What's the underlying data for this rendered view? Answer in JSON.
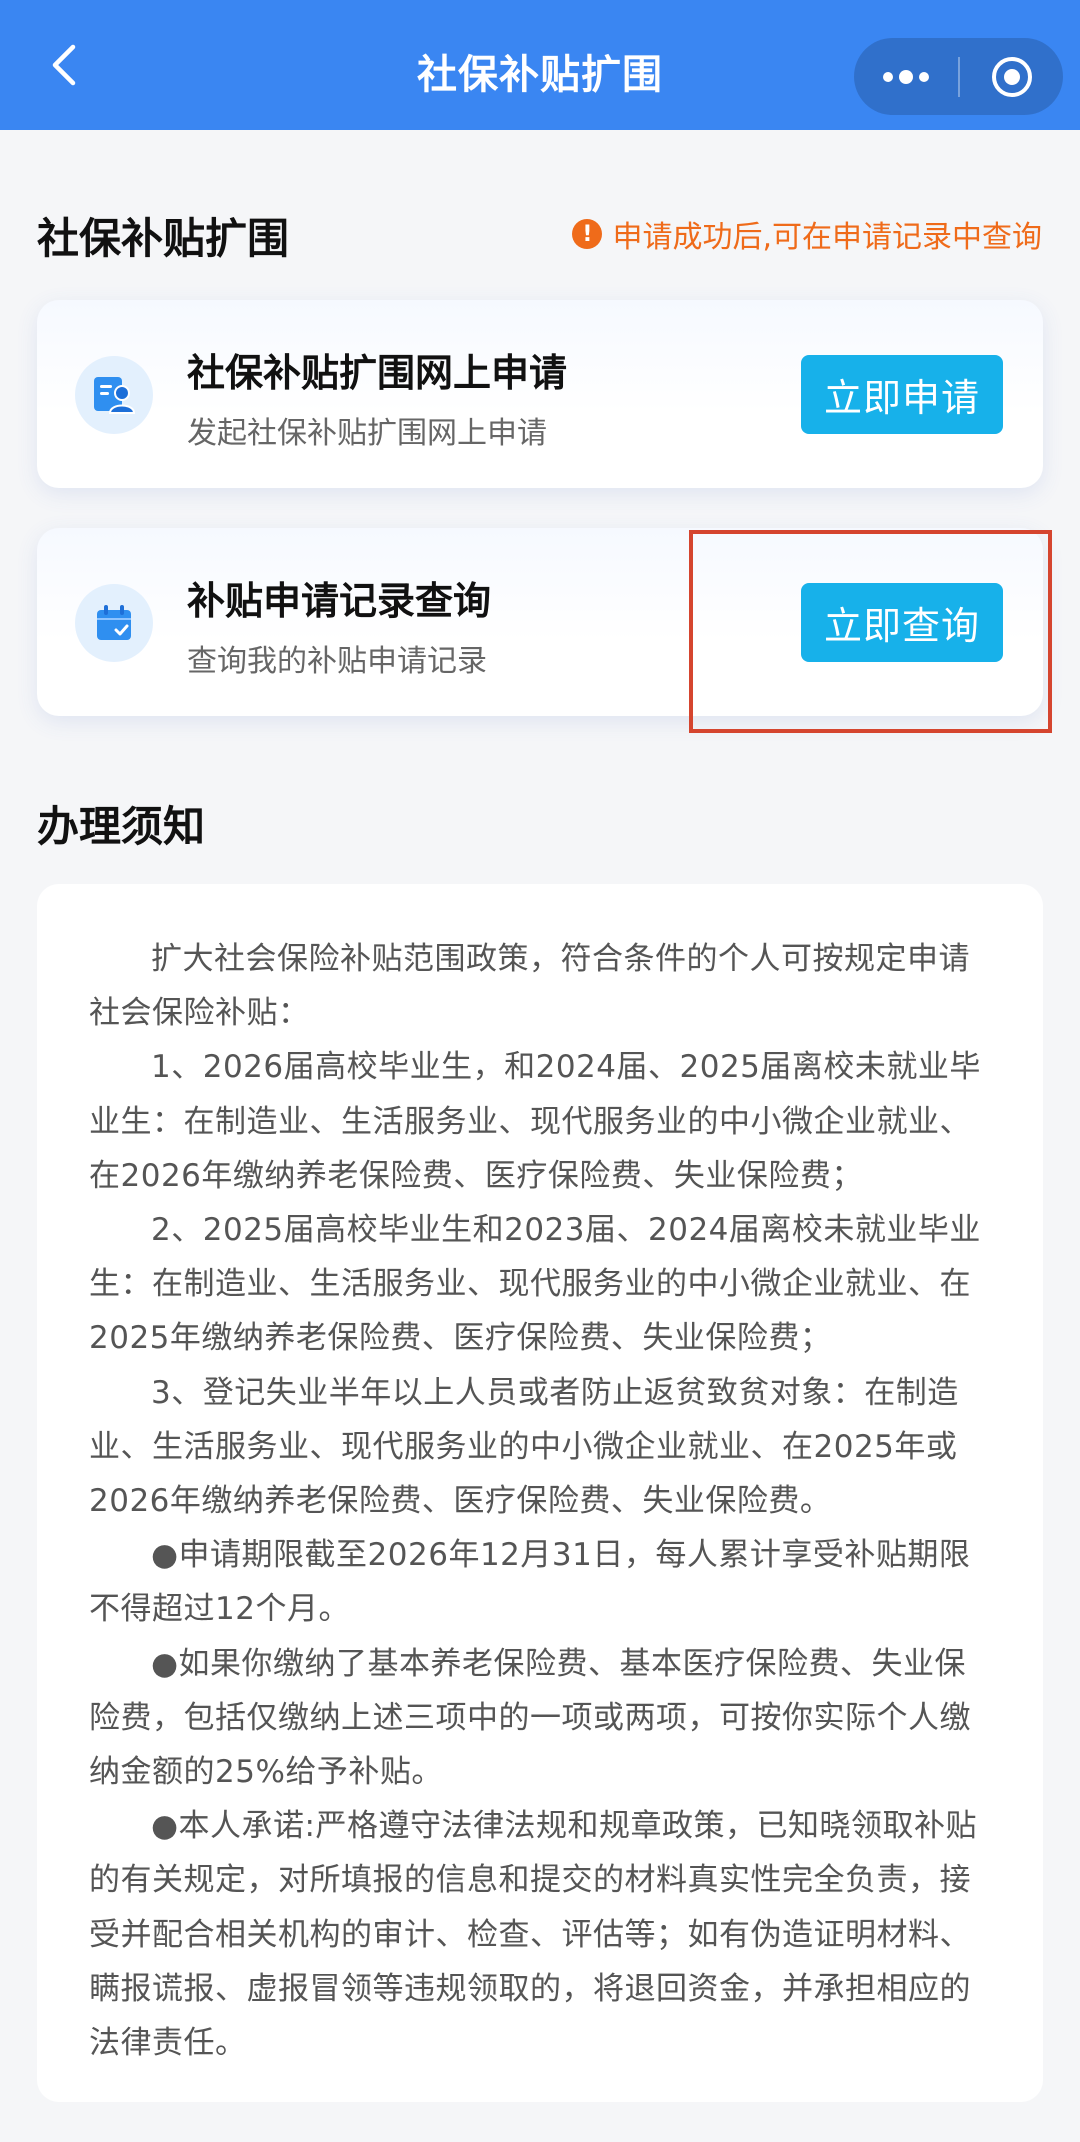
{
  "header": {
    "title": "社保补贴扩围"
  },
  "section": {
    "title": "社保补贴扩围",
    "notice": "申请成功后,可在申请记录中查询"
  },
  "cards": [
    {
      "title": "社保补贴扩围网上申请",
      "subtitle": "发起社保补贴扩围网上申请",
      "button": "立即申请",
      "icon": "apply-person-icon"
    },
    {
      "title": "补贴申请记录查询",
      "subtitle": "查询我的补贴申请记录",
      "button": "立即查询",
      "icon": "calendar-check-icon"
    }
  ],
  "guide": {
    "title": "办理须知",
    "paragraphs": [
      "扩大社会保险补贴范围政策，符合条件的个人可按规定申请社会保险补贴：",
      "1、2026届高校毕业生，和2024届、2025届离校未就业毕业生：在制造业、生活服务业、现代服务业的中小微企业就业、在2026年缴纳养老保险费、医疗保险费、失业保险费；",
      "2、2025届高校毕业生和2023届、2024届离校未就业毕业生：在制造业、生活服务业、现代服务业的中小微企业就业、在2025年缴纳养老保险费、医疗保险费、失业保险费；",
      "3、登记失业半年以上人员或者防止返贫致贫对象：在制造业、生活服务业、现代服务业的中小微企业就业、在2025年或2026年缴纳养老保险费、医疗保险费、失业保险费。",
      "●申请期限截至2026年12月31日，每人累计享受补贴期限不得超过12个月。",
      "●如果你缴纳了基本养老保险费、基本医疗保险费、失业保险费，包括仅缴纳上述三项中的一项或两项，可按你实际个人缴纳金额的25%给予补贴。",
      "●本人承诺:严格遵守法律法规和规章政策，已知晓领取补贴的有关规定，对所填报的信息和提交的材料真实性完全负责，接受并配合相关机构的审计、检查、评估等；如有伪造证明材料、瞒报谎报、虚报冒领等违规领取的，将退回资金，并承担相应的法律责任。"
    ]
  },
  "colors": {
    "header_bg": "#3a86f2",
    "button_bg": "#17b1ea",
    "notice": "#ef6b1a",
    "highlight_border": "#d5452f"
  }
}
